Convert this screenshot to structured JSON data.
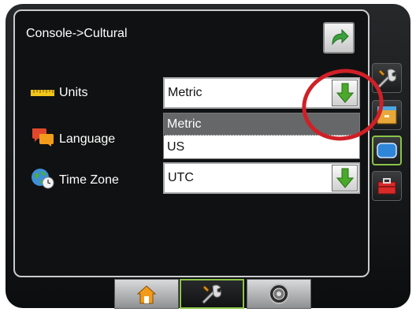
{
  "header": {
    "breadcrumb": "Console->Cultural"
  },
  "settings": {
    "units": {
      "label": "Units",
      "value": "Metric",
      "options": [
        "Metric",
        "US"
      ]
    },
    "language": {
      "label": "Language"
    },
    "timezone": {
      "label": "Time Zone",
      "value": "UTC"
    }
  },
  "colors": {
    "accent_green": "#8bc34a",
    "annotation_red": "#cf2027"
  },
  "icons": {
    "back": "return-arrow-icon",
    "dropdown": "green-down-arrow-icon",
    "side": [
      "tools-icon",
      "folder-icon",
      "display-icon",
      "toolbox-icon"
    ],
    "bottom": [
      "home-icon",
      "tools-icon",
      "speedometer-icon"
    ]
  }
}
